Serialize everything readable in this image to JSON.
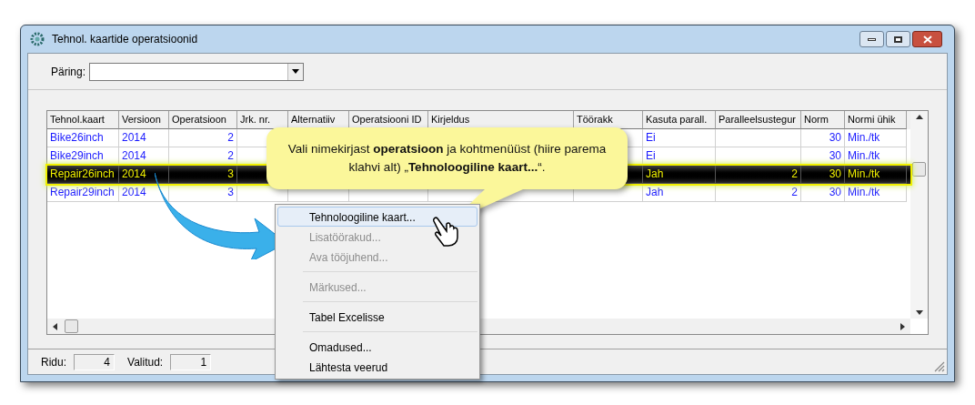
{
  "window": {
    "title": "Tehnol. kaartide operatsioonid"
  },
  "query": {
    "label": "Päring:"
  },
  "table": {
    "columns": [
      "Tehnol.kaart",
      "Versioon",
      "Operatsioon",
      "Jrk. nr.",
      "Alternatiiv",
      "Operatsiooni ID",
      "Kirjeldus",
      "Töörakk",
      "Kasuta parall.",
      "Paralleelsustegur",
      "Norm",
      "Normi ühik"
    ],
    "rows": [
      {
        "selected": false,
        "cells": [
          "Bike26inch",
          "2014",
          "2",
          null,
          null,
          null,
          null,
          null,
          "Ei",
          null,
          "30",
          "Min./tk"
        ]
      },
      {
        "selected": false,
        "cells": [
          "Bike29inch",
          "2014",
          "2",
          null,
          null,
          null,
          null,
          null,
          "Ei",
          null,
          "30",
          "Min./tk"
        ]
      },
      {
        "selected": true,
        "cells": [
          "Repair26inch",
          "2014",
          "3",
          null,
          null,
          null,
          null,
          null,
          "Jah",
          "2",
          "30",
          "Min./tk"
        ]
      },
      {
        "selected": false,
        "cells": [
          "Repair29inch",
          "2014",
          "3",
          null,
          null,
          null,
          null,
          null,
          "Jah",
          "2",
          "30",
          "Min./tk"
        ]
      }
    ]
  },
  "status_bar": [
    {
      "label": "Ridu:",
      "value": "4"
    },
    {
      "label": "Valitud:",
      "value": "1"
    }
  ],
  "callout": {
    "text": "Vali nimekirjast **operatsioon** ja kohtmenüüst (hiire parema klahvi alt) „**Tehnoloogiline  kaart...**“."
  },
  "context_menu": {
    "groups": [
      [
        {
          "label": "Tehnoloogiline kaart...",
          "disabled": false,
          "selected": true
        },
        {
          "label": "Lisatöörakud...",
          "disabled": true,
          "selected": false
        },
        {
          "label": "Ava tööjuhend...",
          "disabled": true,
          "selected": false
        }
      ],
      [
        {
          "label": "Märkused...",
          "disabled": true,
          "selected": false
        }
      ],
      [
        {
          "label": "Tabel Excelisse",
          "disabled": false,
          "selected": false
        }
      ],
      [
        {
          "label": "Omadused...",
          "disabled": false,
          "selected": false
        },
        {
          "label": "Lähtesta veerud",
          "disabled": false,
          "selected": false
        }
      ]
    ]
  }
}
